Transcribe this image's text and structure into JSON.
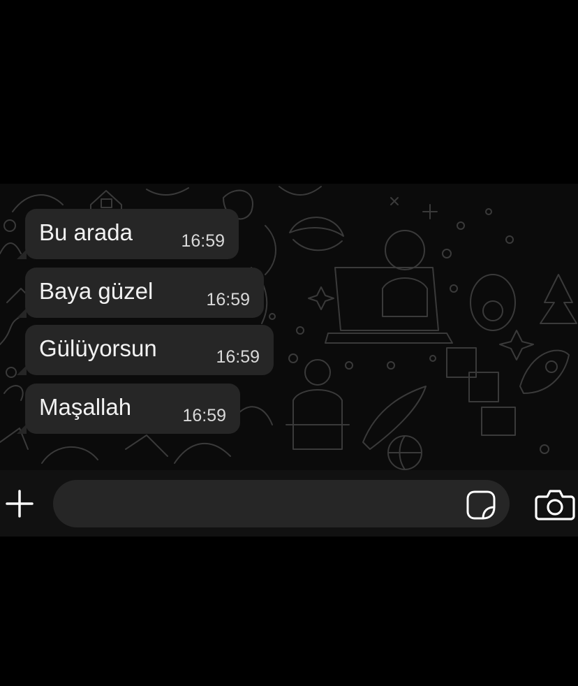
{
  "chat": {
    "messages": [
      {
        "text": "Bu arada",
        "time": "16:59"
      },
      {
        "text": "Baya güzel",
        "time": "16:59"
      },
      {
        "text": "Gülüyorsun",
        "time": "16:59"
      },
      {
        "text": "Maşallah",
        "time": "16:59"
      }
    ]
  },
  "composer": {
    "value": "",
    "placeholder": "",
    "icons": {
      "attach": "plus-icon",
      "sticker": "sticker-icon",
      "camera": "camera-icon"
    }
  },
  "colors": {
    "background": "#000000",
    "wallpaper": "#0b0b0b",
    "bubble": "#262626",
    "text": "#f2f2f2",
    "icon": "#ffffff"
  }
}
